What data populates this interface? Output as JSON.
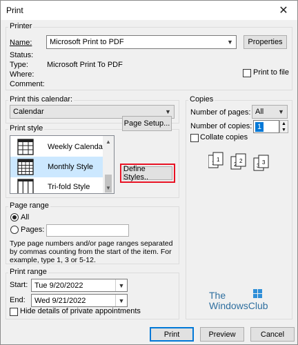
{
  "window": {
    "title": "Print",
    "close": "✕"
  },
  "printer": {
    "group_label": "Printer",
    "name_label": "Name:",
    "name_value": "Microsoft Print to PDF",
    "properties_button": "Properties",
    "status_label": "Status:",
    "type_label": "Type:",
    "type_value": "Microsoft Print To PDF",
    "where_label": "Where:",
    "comment_label": "Comment:",
    "print_to_file": "Print to file"
  },
  "calendar": {
    "label": "Print this calendar:",
    "value": "Calendar"
  },
  "print_style": {
    "group_label": "Print style",
    "items": [
      {
        "label": "Weekly Calendar S"
      },
      {
        "label": "Monthly Style"
      },
      {
        "label": "Tri-fold Style"
      }
    ],
    "page_setup_button": "Page Setup...",
    "define_styles_button": "Define Styles..",
    "highlight_color": "#e81123"
  },
  "copies": {
    "group_label": "Copies",
    "num_pages_label": "Number of pages:",
    "num_pages_value": "All",
    "num_copies_label": "Number of copies:",
    "num_copies_value": "1",
    "collate_label": "Collate copies",
    "collate_icons": [
      "1",
      "1",
      "2",
      "2",
      "3",
      "3"
    ]
  },
  "page_range": {
    "group_label": "Page range",
    "all_label": "All",
    "pages_label": "Pages:",
    "help_text": "Type page numbers and/or page ranges separated by commas counting from the start of the item.  For example, type 1, 3 or 5-12."
  },
  "print_range": {
    "group_label": "Print range",
    "start_label": "Start:",
    "start_value": "Tue 9/20/2022",
    "end_label": "End:",
    "end_value": "Wed 9/21/2022",
    "hide_details_label": "Hide details of private appointments"
  },
  "watermark": {
    "line1": "The",
    "line2": "WindowsClub"
  },
  "footer": {
    "print_button": "Print",
    "preview_button": "Preview",
    "cancel_button": "Cancel"
  }
}
